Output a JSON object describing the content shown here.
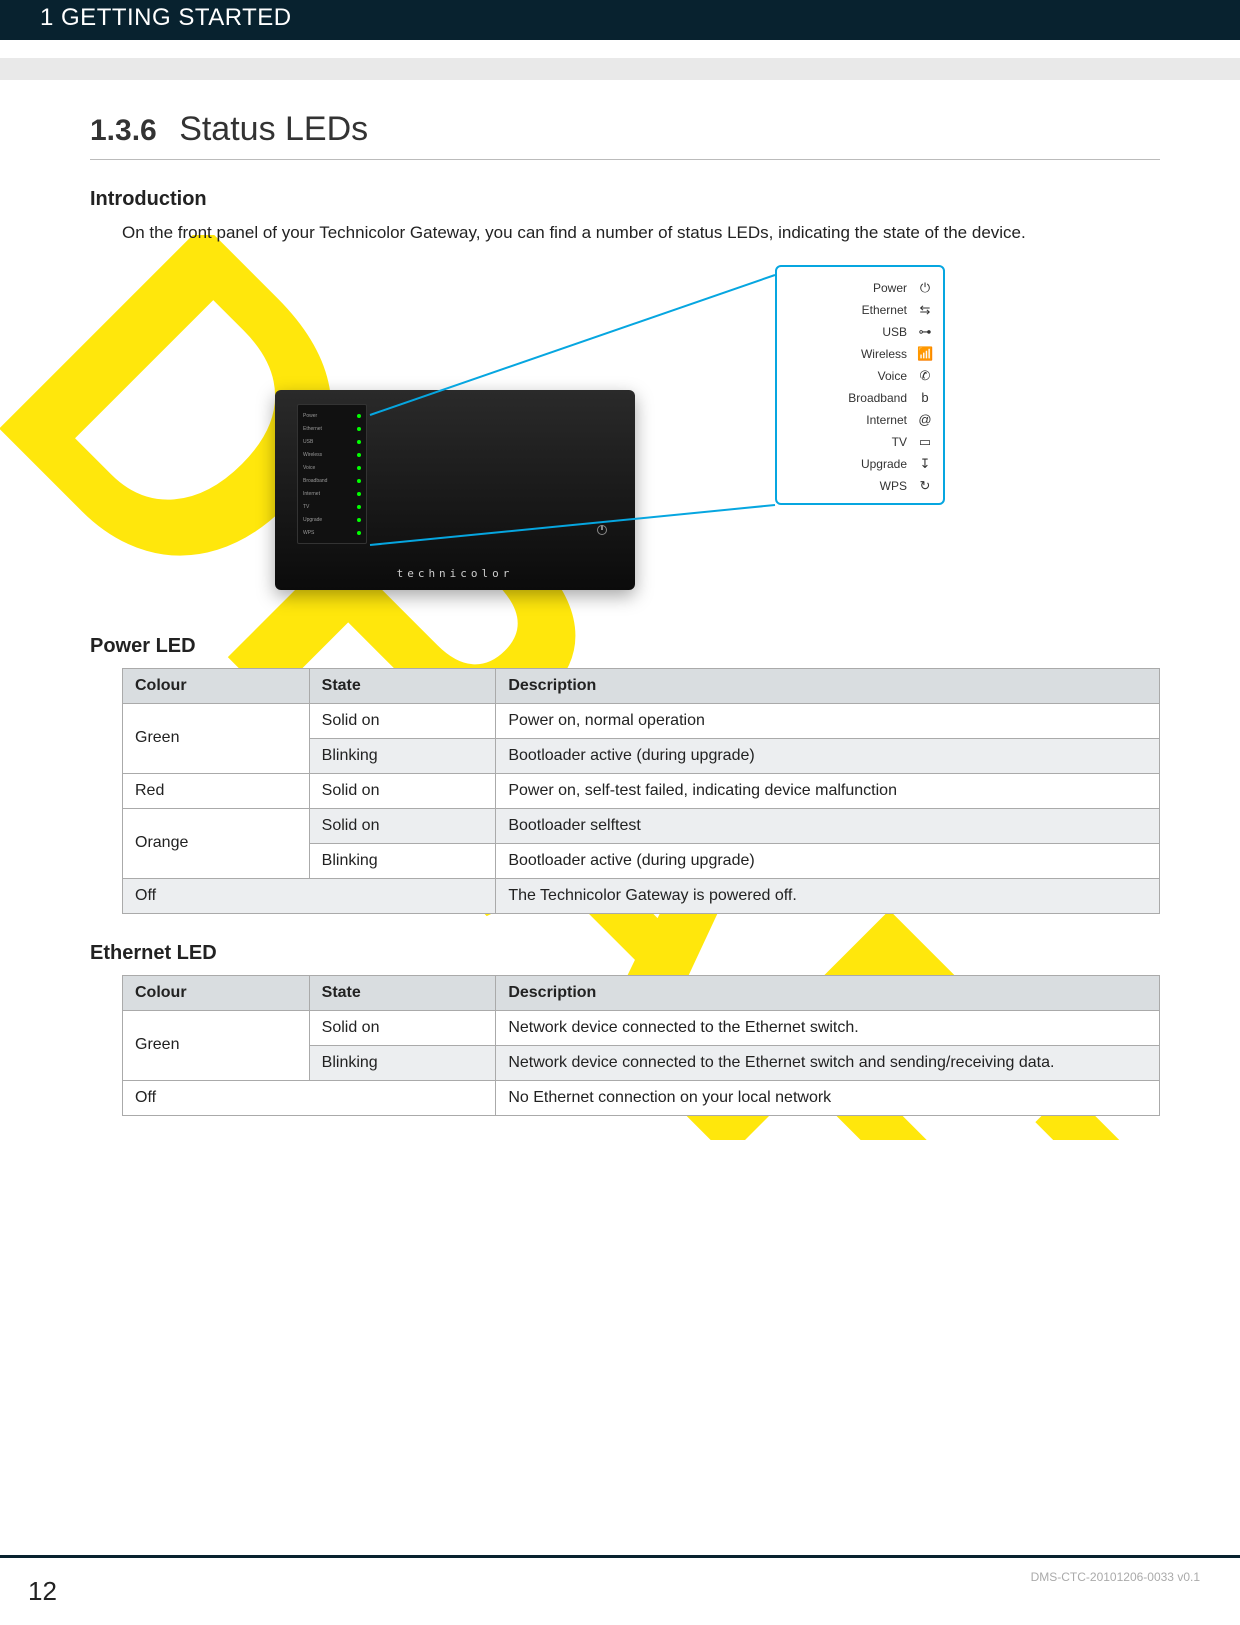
{
  "header": {
    "chapter": "1 GETTING STARTED"
  },
  "page": {
    "section_number": "1.3.6",
    "section_title": "Status LEDs",
    "watermark": "DRAFT"
  },
  "intro": {
    "heading": "Introduction",
    "text": "On the front panel of your Technicolor Gateway, you can find a number of status LEDs, indicating the state of the device."
  },
  "figure": {
    "brand": "technicolor",
    "callout_labels": [
      {
        "name": "Power",
        "icon": "power-icon",
        "glyph": "⏻"
      },
      {
        "name": "Ethernet",
        "icon": "ethernet-icon",
        "glyph": "⇆"
      },
      {
        "name": "USB",
        "icon": "usb-icon",
        "glyph": "⊶"
      },
      {
        "name": "Wireless",
        "icon": "wireless-icon",
        "glyph": "📶"
      },
      {
        "name": "Voice",
        "icon": "voice-icon",
        "glyph": "✆"
      },
      {
        "name": "Broadband",
        "icon": "broadband-icon",
        "glyph": "b"
      },
      {
        "name": "Internet",
        "icon": "internet-icon",
        "glyph": "@"
      },
      {
        "name": "TV",
        "icon": "tv-icon",
        "glyph": "▭"
      },
      {
        "name": "Upgrade",
        "icon": "upgrade-icon",
        "glyph": "↧"
      },
      {
        "name": "WPS",
        "icon": "wps-icon",
        "glyph": "↻"
      }
    ]
  },
  "power_led": {
    "heading": "Power LED",
    "headers": [
      "Colour",
      "State",
      "Description"
    ],
    "rows": [
      {
        "colour": "Green",
        "state": "Solid on",
        "desc": "Power on, normal operation",
        "shade": false,
        "colour_rowspan": 2
      },
      {
        "colour": "",
        "state": "Blinking",
        "desc": "Bootloader active (during upgrade)",
        "shade": true
      },
      {
        "colour": "Red",
        "state": "Solid on",
        "desc": "Power on, self-test failed, indicating device malfunction",
        "shade": false,
        "colour_rowspan": 1
      },
      {
        "colour": "Orange",
        "state": "Solid on",
        "desc": "Bootloader selftest",
        "shade": true,
        "colour_rowspan": 2
      },
      {
        "colour": "",
        "state": "Blinking",
        "desc": "Bootloader active (during upgrade)",
        "shade": false
      },
      {
        "colour": "Off",
        "state": "",
        "desc": "The Technicolor Gateway is powered off.",
        "shade": true,
        "off_span": true
      }
    ]
  },
  "ethernet_led": {
    "heading": "Ethernet LED",
    "headers": [
      "Colour",
      "State",
      "Description"
    ],
    "rows": [
      {
        "colour": "Green",
        "state": "Solid on",
        "desc": "Network device connected to the Ethernet switch.",
        "shade": false,
        "colour_rowspan": 2
      },
      {
        "colour": "",
        "state": "Blinking",
        "desc": "Network device connected to the Ethernet switch and sending/receiving data.",
        "shade": true
      },
      {
        "colour": "Off",
        "state": "",
        "desc": "No Ethernet connection on your local network",
        "shade": false,
        "off_span": true
      }
    ]
  },
  "footer": {
    "page_number": "12",
    "doc_id": "DMS-CTC-20101206-0033 v0.1"
  }
}
